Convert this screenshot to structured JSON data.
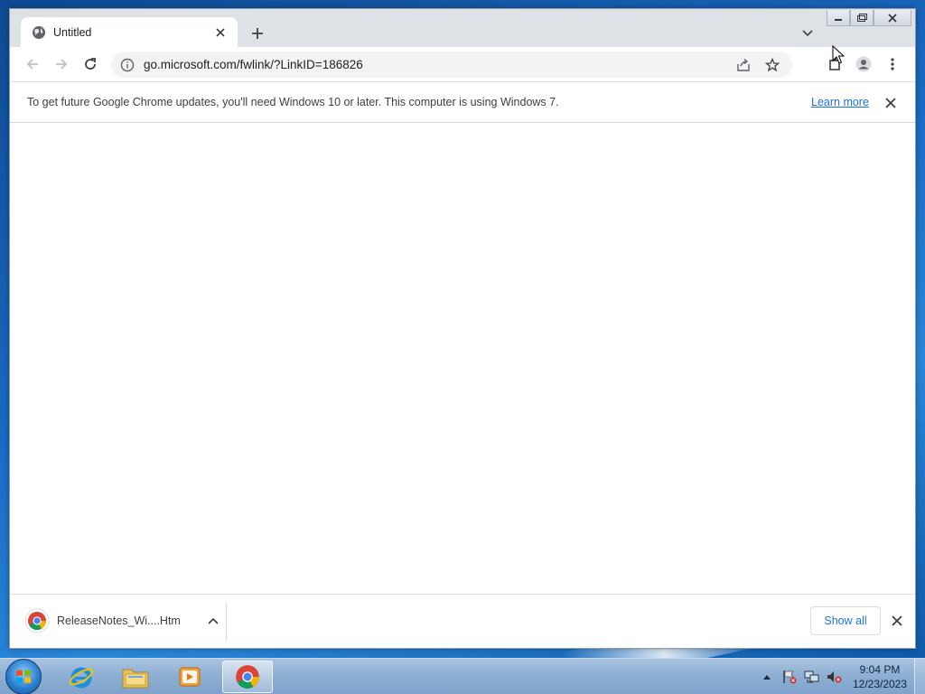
{
  "browser": {
    "tab": {
      "title": "Untitled",
      "favicon": "globe-icon"
    },
    "address_bar": {
      "url": "go.microsoft.com/fwlink/?LinkID=186826"
    },
    "infobar": {
      "message": "To get future Google Chrome updates, you'll need Windows 10 or later. This computer is using Windows 7.",
      "link": "Learn more"
    },
    "download_shelf": {
      "items": [
        {
          "name": "ReleaseNotes_Wi....Htm",
          "icon": "chrome-icon"
        }
      ],
      "show_all": "Show all"
    }
  },
  "taskbar": {
    "apps": [
      "ie-icon",
      "explorer-icon",
      "media-player-icon",
      "chrome-icon"
    ],
    "clock": {
      "time": "9:04 PM",
      "date": "12/23/2023"
    }
  },
  "colors": {
    "accent": "#1a73e8",
    "tabstrip": "#dee1e6",
    "omnibox": "#f1f3f4"
  }
}
